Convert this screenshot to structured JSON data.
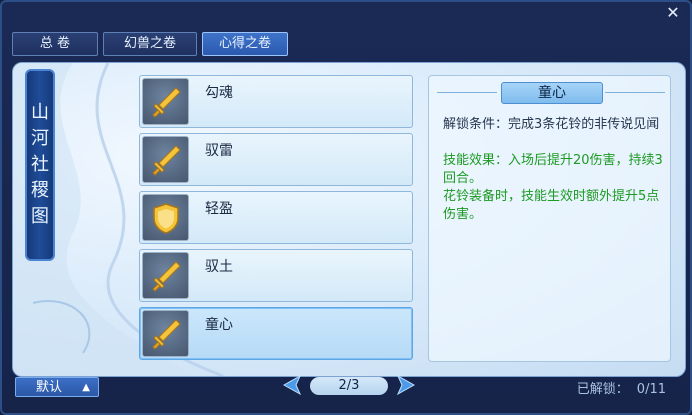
{
  "window": {
    "close_glyph": "✕"
  },
  "tabs": [
    {
      "label": "总 卷",
      "active": false
    },
    {
      "label": "幻兽之卷",
      "active": false
    },
    {
      "label": "心得之卷",
      "active": true
    }
  ],
  "scroll_banner": {
    "chars": [
      "山",
      "河",
      "社",
      "稷",
      "图"
    ]
  },
  "items": [
    {
      "label": "勾魂",
      "icon": "sword-icon"
    },
    {
      "label": "驭雷",
      "icon": "sword-icon"
    },
    {
      "label": "轻盈",
      "icon": "shield-icon"
    },
    {
      "label": "驭土",
      "icon": "sword-icon"
    },
    {
      "label": "童心",
      "icon": "sword-icon",
      "selected": true
    }
  ],
  "detail": {
    "title": "童心",
    "unlock_condition": "解锁条件：完成3条花铃的非传说见闻",
    "effect_1": "技能效果：入场后提升20伤害，持续3回合。",
    "effect_2": "花铃装备时，技能生效时额外提升5点伤害。"
  },
  "footer": {
    "default_label": "默认",
    "dropdown_glyph": "▲",
    "page_indicator": "2/3",
    "unlocked_label": "已解锁：",
    "unlocked_value": "0/11"
  },
  "colors": {
    "accent": "#3e73c9",
    "effect_text": "#1c9a22",
    "background": "#1a2a55"
  }
}
